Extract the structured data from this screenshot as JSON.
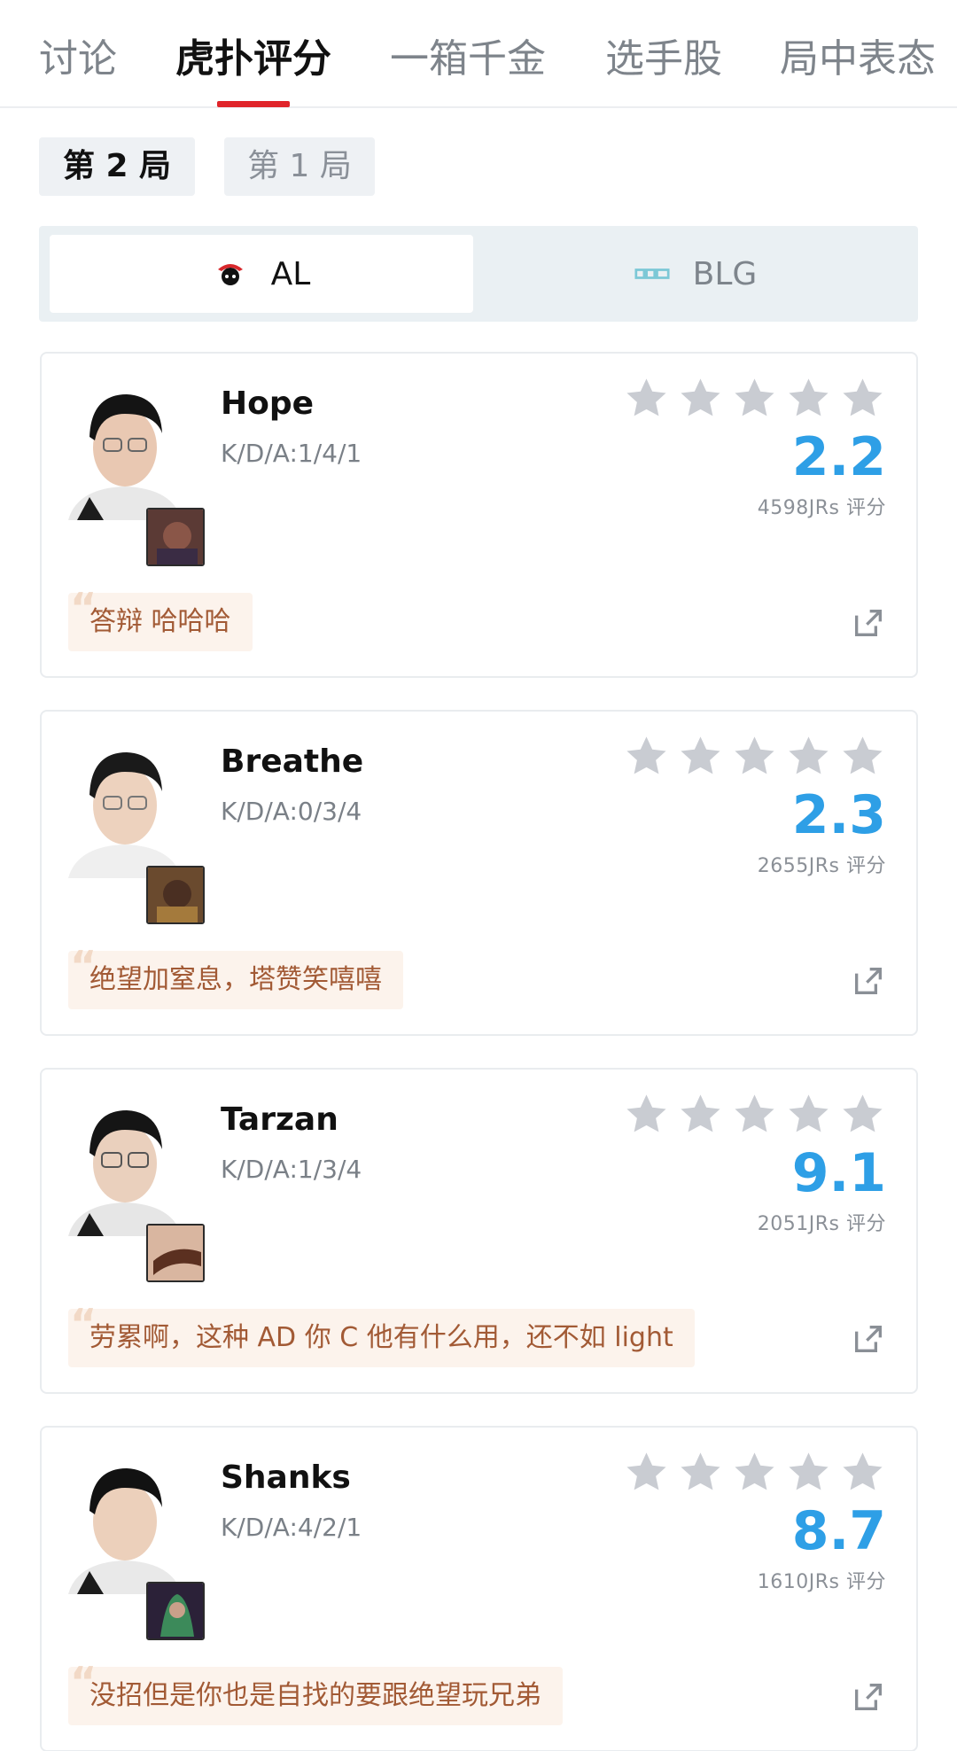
{
  "tabs": [
    {
      "label": "讨论"
    },
    {
      "label": "虎扑评分"
    },
    {
      "label": "一箱千金"
    },
    {
      "label": "选手股"
    },
    {
      "label": "局中表态"
    }
  ],
  "games": [
    {
      "label": "第 2 局"
    },
    {
      "label": "第 1 局"
    }
  ],
  "teams": [
    {
      "name": "AL"
    },
    {
      "name": "BLG"
    }
  ],
  "colors": {
    "score": "#2e9fe6",
    "star_empty": "#c9ccd2",
    "tab_active_underline": "#e0242a",
    "comment_text": "#a25a35",
    "comment_bg": "#fcf3ec"
  },
  "players": [
    {
      "name": "Hope",
      "kda": "K/D/A:1/4/1",
      "score": "2.2",
      "votes": "4598JRs 评分",
      "comment": "答辩 哈哈哈",
      "avatar_icon": "player-photo",
      "champion_icon": "champion-portrait"
    },
    {
      "name": "Breathe",
      "kda": "K/D/A:0/3/4",
      "score": "2.3",
      "votes": "2655JRs 评分",
      "comment": "绝望加窒息，塔赞笑嘻嘻",
      "avatar_icon": "player-photo",
      "champion_icon": "champion-portrait"
    },
    {
      "name": "Tarzan",
      "kda": "K/D/A:1/3/4",
      "score": "9.1",
      "votes": "2051JRs 评分",
      "comment": "劳累啊，这种 AD 你 C 他有什么用，还不如 light",
      "avatar_icon": "player-photo",
      "champion_icon": "champion-portrait"
    },
    {
      "name": "Shanks",
      "kda": "K/D/A:4/2/1",
      "score": "8.7",
      "votes": "1610JRs 评分",
      "comment": "没招但是你也是自找的要跟绝望玩兄弟",
      "avatar_icon": "player-photo",
      "champion_icon": "champion-portrait"
    }
  ]
}
